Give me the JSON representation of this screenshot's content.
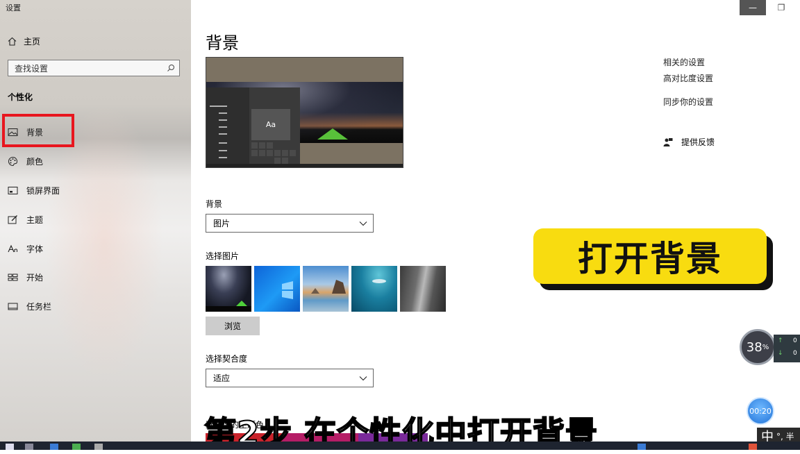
{
  "window": {
    "title": "设置",
    "minimize_label": "—",
    "restore_label": "❐"
  },
  "sidebar": {
    "home_label": "主页",
    "search_placeholder": "查找设置",
    "section_title": "个性化",
    "items": [
      {
        "label": "背景",
        "icon": "picture-icon"
      },
      {
        "label": "颜色",
        "icon": "palette-icon"
      },
      {
        "label": "锁屏界面",
        "icon": "lockscreen-icon"
      },
      {
        "label": "主题",
        "icon": "theme-icon"
      },
      {
        "label": "字体",
        "icon": "font-icon"
      },
      {
        "label": "开始",
        "icon": "start-icon"
      },
      {
        "label": "任务栏",
        "icon": "taskbar-icon"
      }
    ]
  },
  "main": {
    "title": "背景",
    "preview_tile_text": "Aa",
    "background_label": "背景",
    "background_value": "图片",
    "choose_picture_label": "选择图片",
    "browse_label": "浏览",
    "fit_label": "选择契合度",
    "fit_value": "适应",
    "next_section_label": "选择你的主题色"
  },
  "related": {
    "title": "相关的设置",
    "links": [
      "高对比度设置",
      "同步你的设置"
    ],
    "feedback_label": "提供反馈"
  },
  "overlay": {
    "banner": "打开背景",
    "subtitle": "第2步 在个性化中打开背景",
    "gauge_value": "38",
    "gauge_unit": "%",
    "net_up": "0",
    "net_down": "0",
    "timer": "00:20",
    "ime_label": "中",
    "ime_extra": "°, 半"
  },
  "colors": {
    "highlight": "#e8161e",
    "banner": "#f8dc10"
  }
}
